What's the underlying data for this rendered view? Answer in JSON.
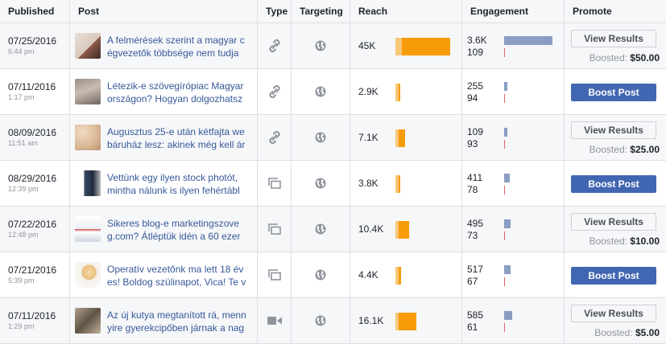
{
  "headers": {
    "published": "Published",
    "post": "Post",
    "type": "Type",
    "targeting": "Targeting",
    "reach": "Reach",
    "engagement": "Engagement",
    "promote": "Promote"
  },
  "colors": {
    "reach_light": "#f7c878",
    "reach_dark": "#f89b09",
    "engagement_bar": "#8b9dc3",
    "engagement_secondary": "#e0626c",
    "boost_button": "#4267b2",
    "link_text": "#365899"
  },
  "rows": [
    {
      "date": "07/25/2016",
      "time": "6:44 pm",
      "text1": "A felmérések szerint a magyar c",
      "text2": "égvezetők többsége nem tudja",
      "type_icon": "link-icon",
      "targeting_icon": "globe-icon",
      "reach": "45K",
      "reach_fraction": 0.95,
      "eng1": "3.6K",
      "eng2": "109",
      "eng1_fraction": 1.0,
      "button": "View Results",
      "boosted_label": "Boosted:",
      "boosted_amount": "$50.00"
    },
    {
      "date": "07/11/2016",
      "time": "1:17 pm",
      "text1": "Létezik-e szövegírópiac Magyar",
      "text2": "országon? Hogyan dolgozhatsz",
      "type_icon": "link-icon",
      "targeting_icon": "globe-icon",
      "reach": "2.9K",
      "reach_fraction": 0.06,
      "eng1": "255",
      "eng2": "94",
      "eng1_fraction": 0.07,
      "button": "Boost Post",
      "boosted_label": "",
      "boosted_amount": ""
    },
    {
      "date": "08/09/2016",
      "time": "11:51 am",
      "text1": "Augusztus 25-e után kétfajta we",
      "text2": "báruház lesz: akinek még kell ár",
      "type_icon": "link-icon",
      "targeting_icon": "globe-icon",
      "reach": "7.1K",
      "reach_fraction": 0.16,
      "eng1": "109",
      "eng2": "93",
      "eng1_fraction": 0.03,
      "button": "View Results",
      "boosted_label": "Boosted:",
      "boosted_amount": "$25.00"
    },
    {
      "date": "08/29/2016",
      "time": "12:39 pm",
      "text1": "Vettünk egy ilyen stock photót,",
      "text2": "mintha nálunk is ilyen fehértábl",
      "type_icon": "photo-album-icon",
      "targeting_icon": "globe-icon",
      "reach": "3.8K",
      "reach_fraction": 0.08,
      "eng1": "411",
      "eng2": "78",
      "eng1_fraction": 0.11,
      "button": "Boost Post",
      "boosted_label": "",
      "boosted_amount": ""
    },
    {
      "date": "07/22/2016",
      "time": "12:48 pm",
      "text1": "Sikeres blog-e marketingszove",
      "text2": "g.com? Átléptük idén a 60 ezer",
      "type_icon": "photo-album-icon",
      "targeting_icon": "globe-icon",
      "reach": "10.4K",
      "reach_fraction": 0.23,
      "eng1": "495",
      "eng2": "73",
      "eng1_fraction": 0.14,
      "button": "View Results",
      "boosted_label": "Boosted:",
      "boosted_amount": "$10.00"
    },
    {
      "date": "07/21/2016",
      "time": "5:39 pm",
      "text1": "Operatív vezetőnk ma lett 18 év",
      "text2": "es! Boldog szülinapot, Vica! Te v",
      "type_icon": "photo-album-icon",
      "targeting_icon": "globe-icon",
      "reach": "4.4K",
      "reach_fraction": 0.1,
      "eng1": "517",
      "eng2": "67",
      "eng1_fraction": 0.14,
      "button": "Boost Post",
      "boosted_label": "",
      "boosted_amount": ""
    },
    {
      "date": "07/11/2016",
      "time": "1:29 pm",
      "text1": "Az új kutya megtanított rá, menn",
      "text2": "yire gyerekcipőben járnak a nag",
      "type_icon": "video-icon",
      "targeting_icon": "globe-icon",
      "reach": "16.1K",
      "reach_fraction": 0.36,
      "eng1": "585",
      "eng2": "61",
      "eng1_fraction": 0.16,
      "button": "View Results",
      "boosted_label": "Boosted:",
      "boosted_amount": "$5.00"
    }
  ]
}
